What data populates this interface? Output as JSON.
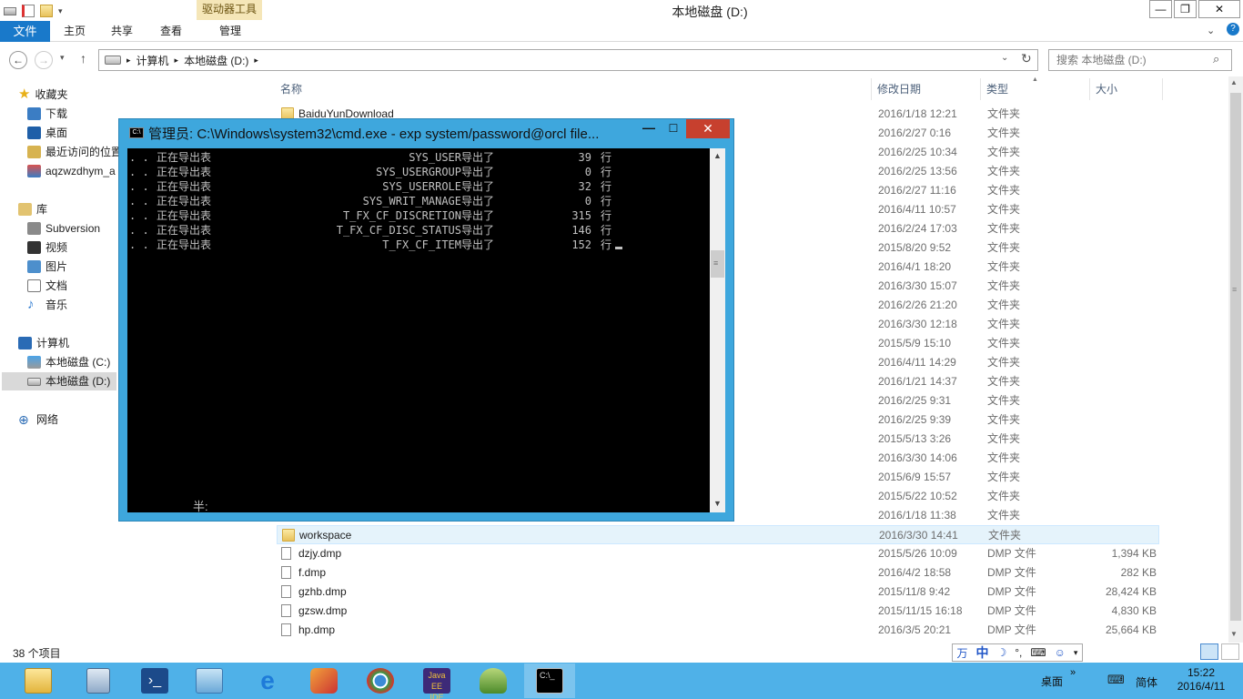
{
  "window": {
    "title": "本地磁盘 (D:)",
    "context_tab": "驱动器工具",
    "min": "—",
    "max": "❐",
    "close": "✕"
  },
  "ribbon": {
    "tabs": [
      "文件",
      "主页",
      "共享",
      "查看",
      "管理"
    ],
    "help_chevron": "⌄",
    "help": "?"
  },
  "address": {
    "back": "←",
    "forward": "→",
    "recent": "▾",
    "up": "↑",
    "path": [
      "计算机",
      "本地磁盘 (D:)"
    ],
    "sep": "▸",
    "dropdown": "⌄",
    "refresh": "↻",
    "search_placeholder": "搜索 本地磁盘 (D:)",
    "search_icon": "⌕"
  },
  "nav": {
    "favorites": {
      "label": "收藏夹",
      "items": [
        "下载",
        "桌面",
        "最近访问的位置",
        "aqzwzdhym_a"
      ]
    },
    "libraries": {
      "label": "库",
      "items": [
        "Subversion",
        "视频",
        "图片",
        "文档",
        "音乐"
      ]
    },
    "computer": {
      "label": "计算机",
      "items": [
        "本地磁盘 (C:)",
        "本地磁盘 (D:)"
      ]
    },
    "network": {
      "label": "网络"
    }
  },
  "columns": {
    "name": "名称",
    "date": "修改日期",
    "type": "类型",
    "size": "大小",
    "sort": "▲"
  },
  "files": [
    {
      "name": "BaiduYunDownload",
      "date": "2016/1/18 12:21",
      "type": "文件夹",
      "size": "",
      "kind": "folder"
    },
    {
      "name": "",
      "date": "2016/2/27 0:16",
      "type": "文件夹",
      "size": "",
      "kind": "folder"
    },
    {
      "name": "",
      "date": "2016/2/25 10:34",
      "type": "文件夹",
      "size": "",
      "kind": "folder"
    },
    {
      "name": "",
      "date": "2016/2/25 13:56",
      "type": "文件夹",
      "size": "",
      "kind": "folder"
    },
    {
      "name": "",
      "date": "2016/2/27 11:16",
      "type": "文件夹",
      "size": "",
      "kind": "folder"
    },
    {
      "name": "",
      "date": "2016/4/11 10:57",
      "type": "文件夹",
      "size": "",
      "kind": "folder"
    },
    {
      "name": "",
      "date": "2016/2/24 17:03",
      "type": "文件夹",
      "size": "",
      "kind": "folder"
    },
    {
      "name": "",
      "date": "2015/8/20 9:52",
      "type": "文件夹",
      "size": "",
      "kind": "folder"
    },
    {
      "name": "",
      "date": "2016/4/1 18:20",
      "type": "文件夹",
      "size": "",
      "kind": "folder"
    },
    {
      "name": "",
      "date": "2016/3/30 15:07",
      "type": "文件夹",
      "size": "",
      "kind": "folder"
    },
    {
      "name": "",
      "date": "2016/2/26 21:20",
      "type": "文件夹",
      "size": "",
      "kind": "folder"
    },
    {
      "name": "",
      "date": "2016/3/30 12:18",
      "type": "文件夹",
      "size": "",
      "kind": "folder"
    },
    {
      "name": "",
      "date": "2015/5/9 15:10",
      "type": "文件夹",
      "size": "",
      "kind": "folder"
    },
    {
      "name": "",
      "date": "2016/4/11 14:29",
      "type": "文件夹",
      "size": "",
      "kind": "folder"
    },
    {
      "name": "",
      "date": "2016/1/21 14:37",
      "type": "文件夹",
      "size": "",
      "kind": "folder"
    },
    {
      "name": "",
      "date": "2016/2/25 9:31",
      "type": "文件夹",
      "size": "",
      "kind": "folder"
    },
    {
      "name": "",
      "date": "2016/2/25 9:39",
      "type": "文件夹",
      "size": "",
      "kind": "folder"
    },
    {
      "name": "",
      "date": "2015/5/13 3:26",
      "type": "文件夹",
      "size": "",
      "kind": "folder"
    },
    {
      "name": "",
      "date": "2016/3/30 14:06",
      "type": "文件夹",
      "size": "",
      "kind": "folder"
    },
    {
      "name": "",
      "date": "2015/6/9 15:57",
      "type": "文件夹",
      "size": "",
      "kind": "folder"
    },
    {
      "name": "",
      "date": "2015/5/22 10:52",
      "type": "文件夹",
      "size": "",
      "kind": "folder"
    },
    {
      "name": "",
      "date": "2016/1/18 11:38",
      "type": "文件夹",
      "size": "",
      "kind": "folder"
    },
    {
      "name": "workspace",
      "date": "2016/3/30 14:41",
      "type": "文件夹",
      "size": "",
      "kind": "folder",
      "highlight": true
    },
    {
      "name": "dzjy.dmp",
      "date": "2015/5/26 10:09",
      "type": "DMP 文件",
      "size": "1,394 KB",
      "kind": "file"
    },
    {
      "name": "f.dmp",
      "date": "2016/4/2 18:58",
      "type": "DMP 文件",
      "size": "282 KB",
      "kind": "file"
    },
    {
      "name": "gzhb.dmp",
      "date": "2015/11/8 9:42",
      "type": "DMP 文件",
      "size": "28,424 KB",
      "kind": "file"
    },
    {
      "name": "gzsw.dmp",
      "date": "2015/11/15 16:18",
      "type": "DMP 文件",
      "size": "4,830 KB",
      "kind": "file"
    },
    {
      "name": "hp.dmp",
      "date": "2016/3/5 20:21",
      "type": "DMP 文件",
      "size": "25,664 KB",
      "kind": "file"
    }
  ],
  "status": {
    "count": "38 个项目"
  },
  "ime_bar": [
    "万",
    "中",
    "☽",
    "°,",
    "⌨",
    "☺",
    "▾"
  ],
  "cmd": {
    "title": "管理员: C:\\Windows\\system32\\cmd.exe - exp  system/password@orcl file...",
    "icon_text": "C:\\",
    "min": "—",
    "max": "☐",
    "close": "✕",
    "lines": [
      {
        "dots": ". .",
        "msg": "正在导出表",
        "table": "SYS_USER",
        "done": "导出了",
        "count": "39",
        "unit": "行"
      },
      {
        "dots": ". .",
        "msg": "正在导出表",
        "table": "SYS_USERGROUP",
        "done": "导出了",
        "count": "0",
        "unit": "行"
      },
      {
        "dots": ". .",
        "msg": "正在导出表",
        "table": "SYS_USERROLE",
        "done": "导出了",
        "count": "32",
        "unit": "行"
      },
      {
        "dots": ". .",
        "msg": "正在导出表",
        "table": "SYS_WRIT_MANAGE",
        "done": "导出了",
        "count": "0",
        "unit": "行"
      },
      {
        "dots": ". .",
        "msg": "正在导出表",
        "table": "T_FX_CF_DISCRETION",
        "done": "导出了",
        "count": "315",
        "unit": "行"
      },
      {
        "dots": ". .",
        "msg": "正在导出表",
        "table": "T_FX_CF_DISC_STATUS",
        "done": "导出了",
        "count": "146",
        "unit": "行"
      },
      {
        "dots": ". .",
        "msg": "正在导出表",
        "table": "T_FX_CF_ITEM",
        "done": "导出了",
        "count": "152",
        "unit": "行"
      }
    ],
    "ime_status": "半:"
  },
  "tray": {
    "desktop": "桌面",
    "chevron": "»",
    "lang": "简体",
    "time": "15:22",
    "date": "2016/4/11"
  },
  "colors": {
    "accent": "#1979ca",
    "taskbar": "#4fb1e8",
    "cmd_frame": "#3ea7dd",
    "close_red": "#c7402e"
  }
}
